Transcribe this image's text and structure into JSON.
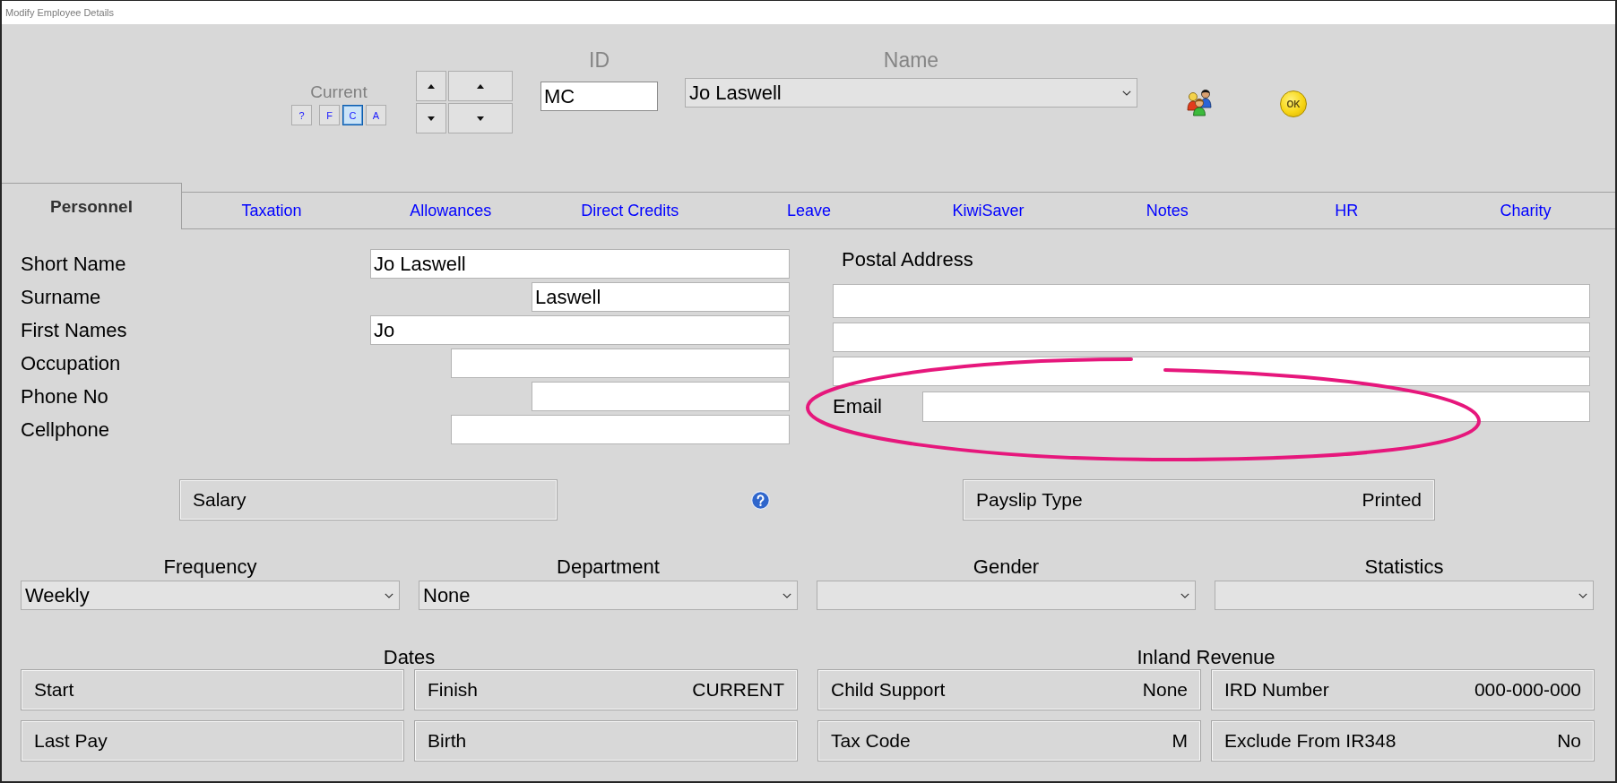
{
  "window": {
    "title": "Modify Employee Details"
  },
  "header": {
    "filter_label": "Current",
    "filter_buttons": [
      {
        "label": "?",
        "selected": false
      },
      {
        "label": "F",
        "selected": false
      },
      {
        "label": "C",
        "selected": true
      },
      {
        "label": "A",
        "selected": false
      }
    ],
    "id_field": {
      "label": "ID",
      "value": "MC"
    },
    "name_field": {
      "label": "Name",
      "value": "Jo Laswell"
    },
    "ok_button": {
      "label": "OK"
    }
  },
  "tabs": [
    {
      "label": "Personnel",
      "selected": true
    },
    {
      "label": "Taxation",
      "selected": false
    },
    {
      "label": "Allowances",
      "selected": false
    },
    {
      "label": "Direct Credits",
      "selected": false
    },
    {
      "label": "Leave",
      "selected": false
    },
    {
      "label": "KiwiSaver",
      "selected": false
    },
    {
      "label": "Notes",
      "selected": false
    },
    {
      "label": "HR",
      "selected": false
    },
    {
      "label": "Charity",
      "selected": false
    }
  ],
  "personnel": {
    "fields": [
      {
        "label": "Short Name",
        "value": "Jo Laswell"
      },
      {
        "label": "Surname",
        "value": "Laswell"
      },
      {
        "label": "First Names",
        "value": "Jo"
      },
      {
        "label": "Occupation"
      },
      {
        "label": "Phone No"
      },
      {
        "label": "Cellphone"
      }
    ],
    "postal_address": {
      "label": "Postal Address"
    },
    "email": {
      "label": "Email"
    },
    "salary": {
      "label": "Salary"
    },
    "payslip_type": {
      "label": "Payslip Type",
      "value": "Printed"
    },
    "selects": [
      {
        "label": "Frequency",
        "value": "Weekly"
      },
      {
        "label": "Department",
        "value": "None"
      },
      {
        "label": "Gender"
      },
      {
        "label": "Statistics"
      }
    ],
    "dates": {
      "title": "Dates",
      "items": [
        {
          "label": "Start"
        },
        {
          "label": "Finish",
          "value": "CURRENT"
        },
        {
          "label": "Last Pay"
        },
        {
          "label": "Birth"
        }
      ]
    },
    "inland_revenue": {
      "title": "Inland Revenue",
      "items": [
        {
          "label": "Child Support",
          "value": "None"
        },
        {
          "label": "IRD Number",
          "value": "000-000-000"
        },
        {
          "label": "Tax Code",
          "value": "M"
        },
        {
          "label": "Exclude From IR348",
          "value": "No"
        }
      ]
    }
  }
}
